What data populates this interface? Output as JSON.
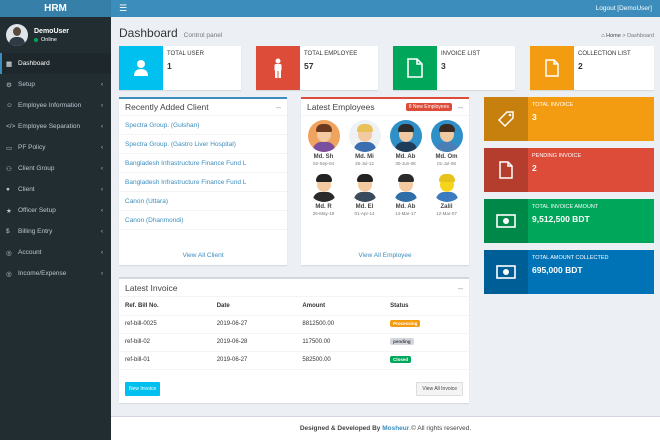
{
  "app": {
    "logo": "HRM",
    "logout": "Logout [DemoUser]"
  },
  "user": {
    "name": "DemoUser",
    "status": "Online"
  },
  "sidebar": {
    "items": [
      {
        "label": "Dashboard",
        "icon": "dashboard-icon",
        "active": true,
        "chevron": false
      },
      {
        "label": "Setup",
        "icon": "gears-icon",
        "chevron": true
      },
      {
        "label": "Employee Information",
        "icon": "users-icon",
        "chevron": true
      },
      {
        "label": "Employee Separation",
        "icon": "code-icon",
        "chevron": true
      },
      {
        "label": "PF Policy",
        "icon": "card-icon",
        "chevron": true
      },
      {
        "label": "Client Group",
        "icon": "group-icon",
        "chevron": true
      },
      {
        "label": "Client",
        "icon": "user-icon",
        "chevron": true
      },
      {
        "label": "Officer Setup",
        "icon": "star-icon",
        "chevron": true
      },
      {
        "label": "Billing Entry",
        "icon": "dollar-icon",
        "chevron": true
      },
      {
        "label": "Account",
        "icon": "globe-icon",
        "chevron": true
      },
      {
        "label": "Income/Expense",
        "icon": "globe-icon",
        "chevron": true
      }
    ]
  },
  "header": {
    "title": "Dashboard",
    "subtitle": "Control panel",
    "crumb_home": "Home",
    "crumb_current": "Dashboard"
  },
  "info_boxes": [
    {
      "label": "TOTAL USER",
      "value": "1",
      "color": "#00c0ef",
      "icon": "user-icon"
    },
    {
      "label": "TOTAL EMPLOYEE",
      "value": "57",
      "color": "#dd4b39",
      "icon": "male-icon"
    },
    {
      "label": "INVOICE LIST",
      "value": "3",
      "color": "#00a65a",
      "icon": "file-icon"
    },
    {
      "label": "COLLECTION LIST",
      "value": "2",
      "color": "#f39c12",
      "icon": "document-icon"
    }
  ],
  "clients": {
    "title": "Recently Added Client",
    "items": [
      "Spectra Group. (Gulshan)",
      "Spectra Group. (Gastro Liver Hospital)",
      "Bangladesh Infrastructure Finance Fund L",
      "Bangladesh Infrastructure Finance Fund L",
      "Canon (Uttara)",
      "Canon (Dhanmondi)"
    ],
    "footer": "View All Client"
  },
  "employees": {
    "title": "Latest Employees",
    "badge": "8 New Employees",
    "items": [
      {
        "name": "Md. Sh",
        "date": "02-Sep-04"
      },
      {
        "name": "Md. Mi",
        "date": "26-Jul-12"
      },
      {
        "name": "Md. Ab",
        "date": "30-Jun-08"
      },
      {
        "name": "Md. Om",
        "date": "01-Jul-08"
      },
      {
        "name": "Md. R",
        "date": "25-May-19"
      },
      {
        "name": "Md. El",
        "date": "01-Apr-14"
      },
      {
        "name": "Md. Ab",
        "date": "14-Mar-17"
      },
      {
        "name": "Zalil",
        "date": "12-Mar-07"
      }
    ],
    "footer": "View All Employee"
  },
  "invoices": {
    "title": "Latest Invoice",
    "columns": [
      "Ref. Bill No.",
      "Date",
      "Amount",
      "Status"
    ],
    "rows": [
      {
        "ref": "ref-bill-0025",
        "date": "2019-06-27",
        "amount": "8812500.00",
        "status": "Processing"
      },
      {
        "ref": "ref-bill-02",
        "date": "2019-06-28",
        "amount": "117500.00",
        "status": "pending"
      },
      {
        "ref": "ref-bill-01",
        "date": "2019-06-27",
        "amount": "582500.00",
        "status": "Closed"
      }
    ],
    "new_button": "New Invoice",
    "all_button": "View All Invoice"
  },
  "summary": [
    {
      "label": "TOTAL INVOICE",
      "value": "3",
      "color": "#f39c12",
      "icon": "tag-icon"
    },
    {
      "label": "PENDING INVOICE",
      "value": "2",
      "color": "#dd4b39",
      "icon": "document-icon"
    },
    {
      "label": "TOTAL INVOICE AMOUNT",
      "value": "9,512,500 BDT",
      "color": "#00a65a",
      "icon": "money-icon"
    },
    {
      "label": "TOTAL AMOUNT COLLECTED",
      "value": "695,000 BDT",
      "color": "#0073b7",
      "icon": "money-icon"
    }
  ],
  "footer": {
    "prefix": "Designed & Developed By",
    "brand": "Mosheur",
    "suffix": ".© All rights reserved."
  }
}
